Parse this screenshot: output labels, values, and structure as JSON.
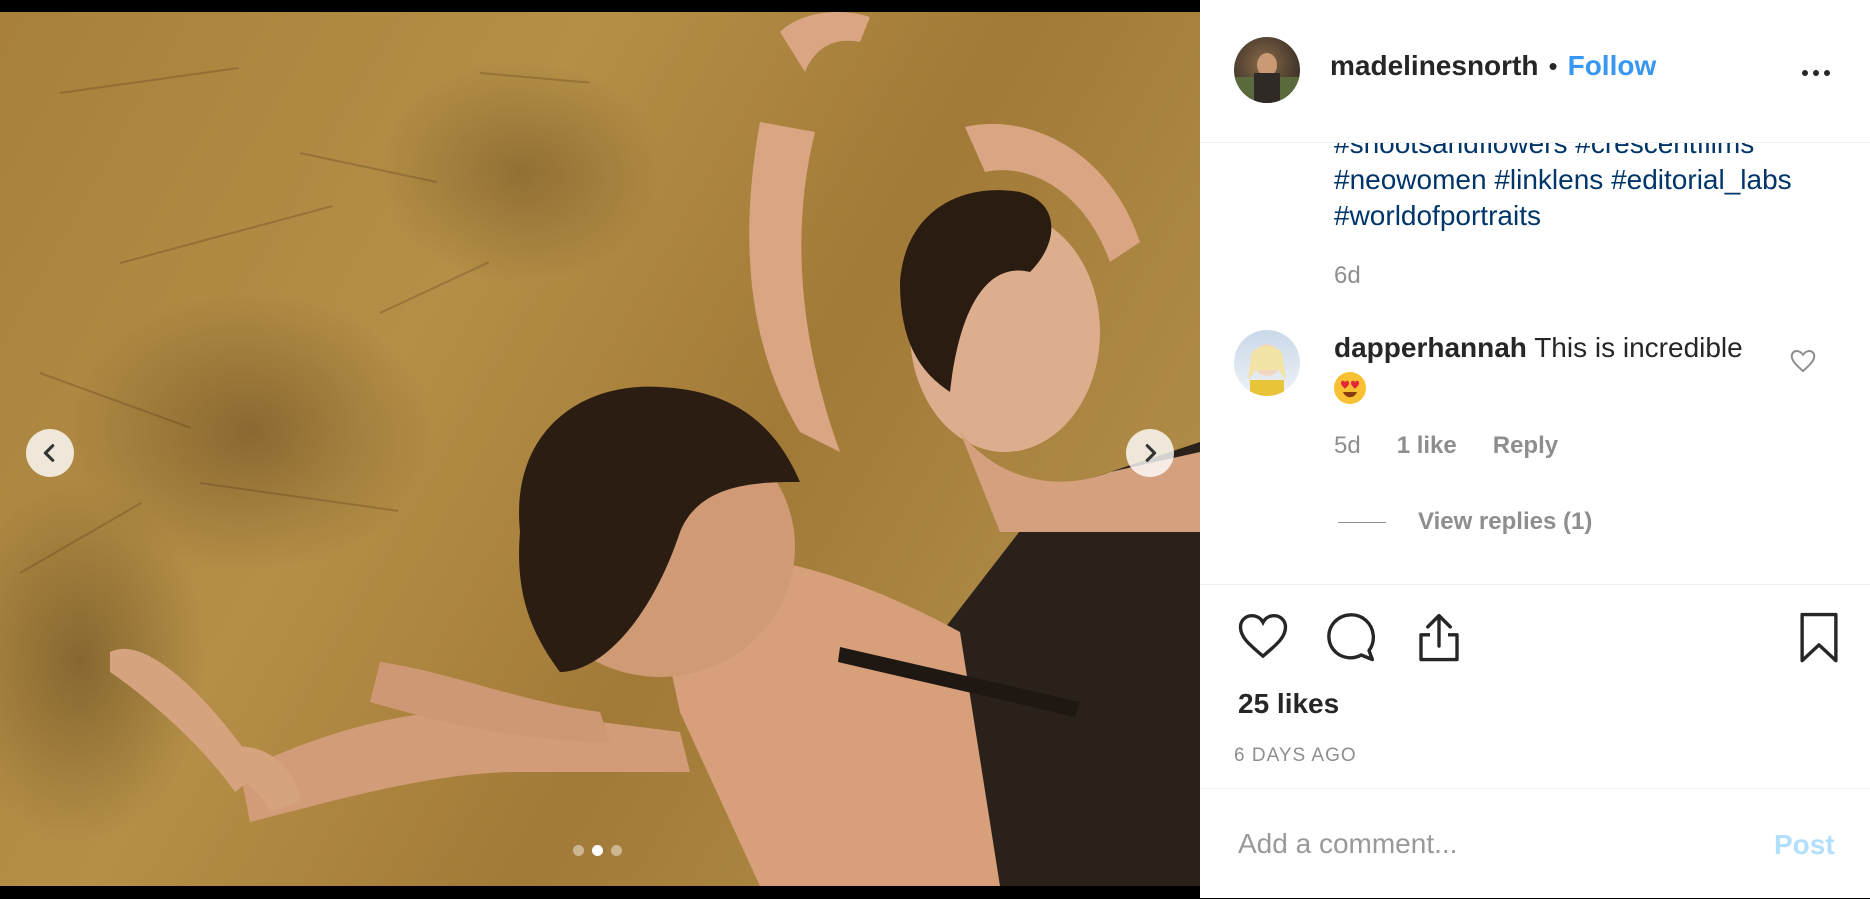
{
  "media": {
    "carousel_dots": 3,
    "active_dot": 1,
    "prev_icon": "chevron-left-icon",
    "next_icon": "chevron-right-icon"
  },
  "header": {
    "username": "madelinesnorth",
    "separator": "•",
    "follow_label": "Follow",
    "more_icon": "more-options-icon"
  },
  "caption": {
    "hashtag_line_partial": "#shootsandflowers #crescentfilms",
    "hashtags": [
      "#neowomen",
      "#linklens",
      "#editorial_labs",
      "#worldofportraits"
    ],
    "time": "6d"
  },
  "comment": {
    "username": "dapperhannah",
    "text": "This is incredible",
    "emoji": "heart-eyes-emoji",
    "time": "5d",
    "likes": "1 like",
    "reply_label": "Reply",
    "view_replies": "View replies (1)"
  },
  "actions": {
    "icons": [
      "heart-icon",
      "comment-icon",
      "share-icon",
      "bookmark-icon"
    ]
  },
  "likes_count": "25 likes",
  "posted_ago": "6 DAYS AGO",
  "add_comment": {
    "placeholder": "Add a comment...",
    "post_label": "Post"
  },
  "colors": {
    "link": "#003569",
    "follow": "#3897f0",
    "muted": "#8e8e8e",
    "post_disabled": "#b2dffc"
  }
}
